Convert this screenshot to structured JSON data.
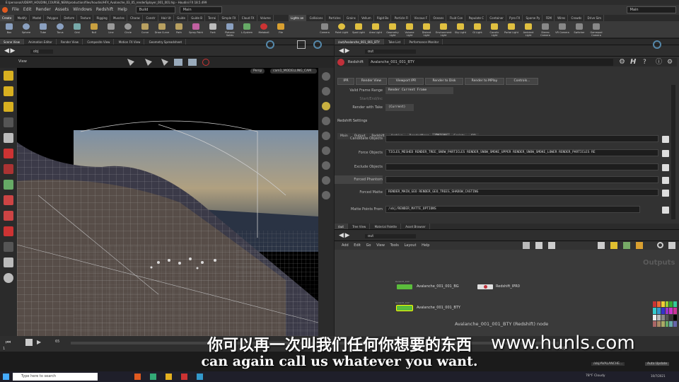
{
  "window": {
    "title": "E:/personal/UDEMY_HOUDINI_COURSE_NEW/production/files/houdini/HFX_Avalanche_03_05_renderSplayer_001_001.hip - Houdini FX 18.5.499"
  },
  "menu": {
    "items": [
      "File",
      "Edit",
      "Render",
      "Assets",
      "Windows",
      "Redshift",
      "Help"
    ],
    "desktop_left": "Build",
    "desktop_main": "Main",
    "desktop_right": "Main"
  },
  "shelf": {
    "tabs": [
      "Create",
      "Modify",
      "Model",
      "Polygon",
      "Deform",
      "Texture",
      "Rigging",
      "Muscles",
      "Charac",
      "Constr",
      "Hair Ut",
      "Guide",
      "Guide B",
      "Terrai",
      "Simple FX",
      "Cloud FX",
      "Volume"
    ],
    "right_tabs": [
      "Lights an",
      "Collisions",
      "Particles",
      "Grains",
      "Vellum",
      "Rigid Bo",
      "Particle Fl",
      "Viscous F",
      "Oceans",
      "Fluid Con",
      "Populate C",
      "Container",
      "Pyro FX",
      "Sparse Py",
      "FEM",
      "Wires",
      "Crowds",
      "Drive Sim"
    ],
    "tools": [
      "Box",
      "Sphere",
      "Tube",
      "Torus",
      "Grid",
      "Null",
      "Line",
      "Circle",
      "Curve",
      "Draw Curve",
      "Path",
      "Spray Paint",
      "Font",
      "Platonic Solids",
      "L-System",
      "Metaball",
      "File"
    ],
    "light_tools": [
      "Camera",
      "Point Light",
      "Spot Light",
      "Area Light",
      "Geometry Light",
      "Volume Light",
      "Distant Light",
      "Environment Light",
      "Sky Light",
      "GI Light",
      "Caustic Light",
      "Portal Light",
      "Ambient Light",
      "Stereo Camera",
      "VR Camera",
      "Switcher",
      "Gamepad Camera"
    ]
  },
  "left_pane": {
    "tabs": [
      "Scene View",
      "Animation Editor",
      "Render View",
      "Composite View",
      "Motion FX View",
      "Geometry Spreadsheet"
    ],
    "path": "obj",
    "view_label": "View",
    "persp": "Persp",
    "cam": "cam1_MODELLING_CAM"
  },
  "right_pane": {
    "tabs": [
      "/out/Avalanche_001_001_BTY",
      "Take List",
      "Performance Monitor"
    ],
    "path": "out",
    "node_type": "Redshift",
    "node_name": "Avalanche_001_001_BTY",
    "buttons": [
      "IPR",
      "Render View",
      "Viewport IPR",
      "Render to Disk",
      "Render to MPlay",
      "Controls..."
    ],
    "valid_frame_range_label": "Valid Frame Range",
    "valid_frame_range_value": "Render Current Frame",
    "start_end_label": "Start/End/Inc",
    "render_with_take_label": "Render with Take",
    "render_with_take_value": "(Current)",
    "settings_label": "Redshift Settings",
    "subtabs": [
      "Main",
      "Output",
      "Redshift",
      "Archive",
      "RenderMaps",
      "Objects",
      "Scripts",
      "IPR"
    ],
    "active_subtab": "Objects",
    "fields": [
      {
        "label": "Candidate Objects",
        "value": ""
      },
      {
        "label": "Force Objects",
        "value": "TICLES_MESHED RENDER_TREE_SNOW_PARTICLES RENDER_SNOW_SMOKE_UPPER RENDER_SNOW_SMOKE_LOWER RENDER_PARTICLES RE"
      },
      {
        "label": "Exclude Objects",
        "value": ""
      },
      {
        "label": "Forced Phantom",
        "value": ""
      },
      {
        "label": "Forced Matte",
        "value": "RENDER_MAIN_GEO RENDER_GEO_TREES_SHADOW_CASTING"
      },
      {
        "label": "Matte Points From",
        "value": "/obj/RENDER_MATTE_OPTIONS"
      }
    ]
  },
  "network": {
    "tabs": [
      "/out",
      "Tree View",
      "Material Palette",
      "Asset Browser"
    ],
    "path": "out",
    "menu": [
      "Add",
      "Edit",
      "Go",
      "View",
      "Tools",
      "Layout",
      "Help"
    ],
    "context_label": "Outputs",
    "nodes": [
      {
        "name": "Avalanche_001_001_BG",
        "type": "Redshift_ROP",
        "color": "#5bbd3c"
      },
      {
        "name": "Redshift_IPR0",
        "type": "",
        "color": "#e0e0e0"
      },
      {
        "name": "Avalanche_001_001_BTY",
        "type": "Redshift_ROP",
        "color": "#5bbd3c"
      }
    ],
    "caption": "Avalanche_001_001_BTY (Redshift) node"
  },
  "timeline": {
    "frame": "65",
    "start": "1",
    "end": "1",
    "end2": "120",
    "end3": "120"
  },
  "overlay": {
    "subtitle_cn": "你可以再一次叫我们任何你想要的东西",
    "subtitle_en": "can again call us whatever you want.",
    "watermark": "www.hunls.com"
  },
  "taskbar": {
    "search_placeholder": "Type here to search",
    "weather": "78°F Cloudy",
    "auto_update": "Auto Update",
    "time": "10/7/2021",
    "status_path": "/obj/AVALANCHE..."
  },
  "colors": {
    "accent": "#5bbd3c",
    "rop_red": "#c0303a",
    "panel": "#323232"
  }
}
